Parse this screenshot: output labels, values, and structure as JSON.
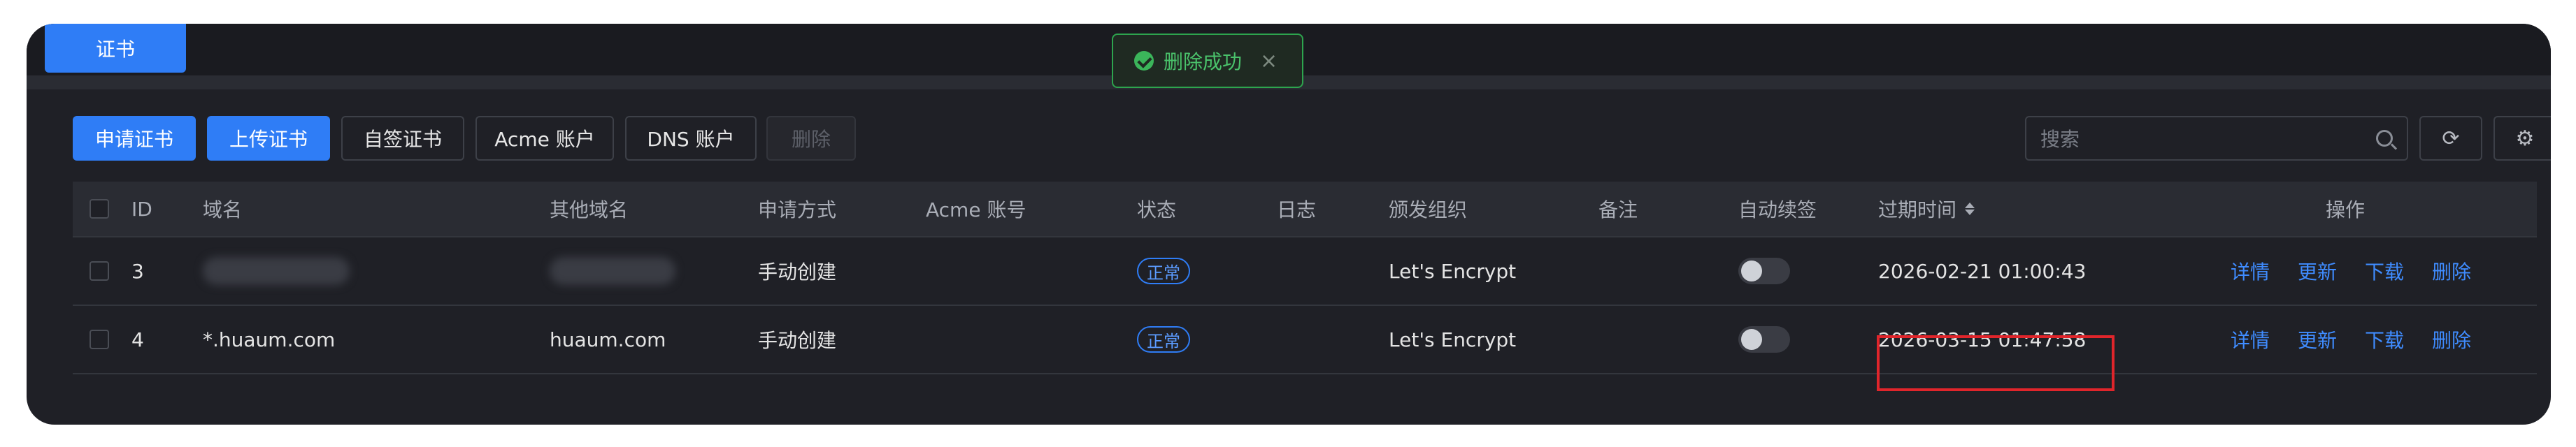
{
  "tabs": {
    "active": "证书"
  },
  "toast": {
    "message": "删除成功",
    "close_symbol": "×"
  },
  "toolbar": {
    "apply_cert": "申请证书",
    "upload_cert": "上传证书",
    "self_signed": "自签证书",
    "acme_account": "Acme 账户",
    "dns_account": "DNS 账户",
    "delete": "删除"
  },
  "search": {
    "placeholder": "搜索"
  },
  "icons": {
    "search": "search-icon",
    "refresh": "refresh-icon",
    "settings": "gear-icon"
  },
  "table": {
    "headers": {
      "id": "ID",
      "domain": "域名",
      "other_domains": "其他域名",
      "method": "申请方式",
      "acme_account": "Acme 账号",
      "status": "状态",
      "log": "日志",
      "issuer": "颁发组织",
      "remark": "备注",
      "auto_renew": "自动续签",
      "expire": "过期时间",
      "actions": "操作"
    },
    "rows": [
      {
        "id": "3",
        "domain": "",
        "other_domains": "",
        "method": "手动创建",
        "acme_account": "",
        "status": "正常",
        "log": "",
        "issuer": "Let's Encrypt",
        "remark": "",
        "auto_renew": false,
        "expire": "2026-02-21 01:00:43",
        "actions": [
          "详情",
          "更新",
          "下载",
          "删除"
        ]
      },
      {
        "id": "4",
        "domain": "*.huaum.com",
        "other_domains": "huaum.com",
        "method": "手动创建",
        "acme_account": "",
        "status": "正常",
        "log": "",
        "issuer": "Let's Encrypt",
        "remark": "",
        "auto_renew": false,
        "expire": "2026-03-15 01:47:58",
        "actions": [
          "详情",
          "更新",
          "下载",
          "删除"
        ]
      }
    ]
  },
  "colors": {
    "primary": "#2f7df6",
    "success": "#3bb55a",
    "highlight": "#e0252b",
    "link": "#3f8cff"
  }
}
